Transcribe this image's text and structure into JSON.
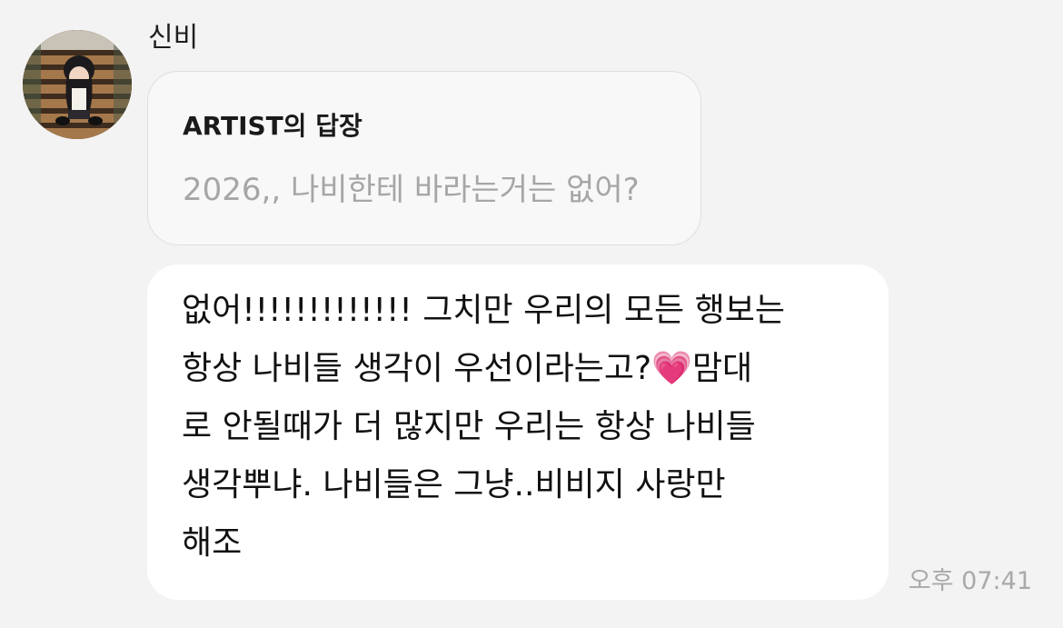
{
  "sender": {
    "name": "신비",
    "avatar_icon": "profile-photo-avatar"
  },
  "reply": {
    "label": "ARTIST의 답장",
    "quoted_text": "2026,, 나비한테 바라는거는 없어?"
  },
  "message": {
    "text": "없어!!!!!!!!!!!!! 그치만 우리의 모든 행보는\n항상 나비들 생각이 우선이라는고?💗맘대\n로 안될때가 더 많지만 우리는 항상 나비들\n생각뿌냐. 나비들은 그냥..비비지 사랑만\n해조",
    "emoji_icon": "growing-heart-emoji"
  },
  "timestamp": "오후 07:41",
  "colors": {
    "background": "#f3f3f4",
    "bubble": "#ffffff",
    "reply_bubble": "#f8f8f8",
    "muted_text": "#a6a6a6"
  }
}
